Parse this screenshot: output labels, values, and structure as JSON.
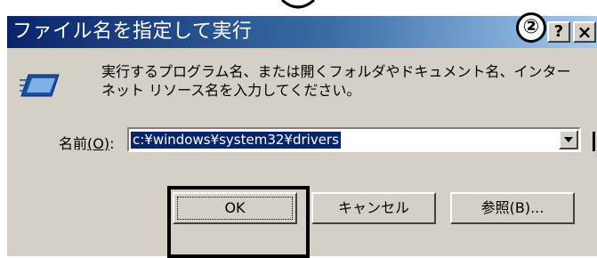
{
  "annotation": {
    "number": "②"
  },
  "dialog": {
    "title": "ファイル名を指定して実行",
    "help_label": "?",
    "close_label": "×",
    "description": "実行するプログラム名、または開くフォルダやドキュメント名、インターネット リソース名を入力してください。",
    "name_label_main": "名前",
    "name_label_key": "(O)",
    "name_label_suffix": ":",
    "name_value": "c:¥windows¥system32¥drivers",
    "ok_label": "OK",
    "cancel_label": "キャンセル",
    "browse_label": "参照(B)..."
  }
}
